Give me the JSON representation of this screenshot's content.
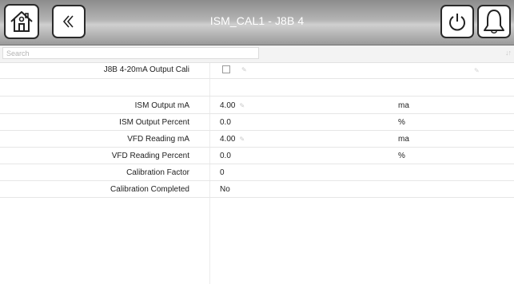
{
  "header": {
    "title": "ISM_CAL1 - J8B 4",
    "icons": {
      "home": "home-icon",
      "back": "double-chevron-left-icon",
      "power": "power-icon",
      "alarm": "bell-icon"
    }
  },
  "search": {
    "placeholder": "Search",
    "value": "",
    "sort_icon": "sort-icon"
  },
  "section": {
    "label": "J8B 4-20mA Output Cali",
    "checked": false
  },
  "rows": [
    {
      "label": "ISM Output mA",
      "value": "4.00",
      "unit": "ma",
      "editable": true
    },
    {
      "label": "ISM Output Percent",
      "value": "0.0",
      "unit": "%",
      "editable": false
    },
    {
      "label": "VFD Reading mA",
      "value": "4.00",
      "unit": "ma",
      "editable": true
    },
    {
      "label": "VFD Reading Percent",
      "value": "0.0",
      "unit": "%",
      "editable": false
    },
    {
      "label": "Calibration Factor",
      "value": "0",
      "unit": "",
      "editable": false
    },
    {
      "label": "Calibration Completed",
      "value": "No",
      "unit": "",
      "editable": false
    }
  ],
  "colors": {
    "header_gradient_mid": "#cfcfcf",
    "header_text": "#ffffff",
    "button_border": "#2a2a2a",
    "divider": "#e6e6e6"
  }
}
